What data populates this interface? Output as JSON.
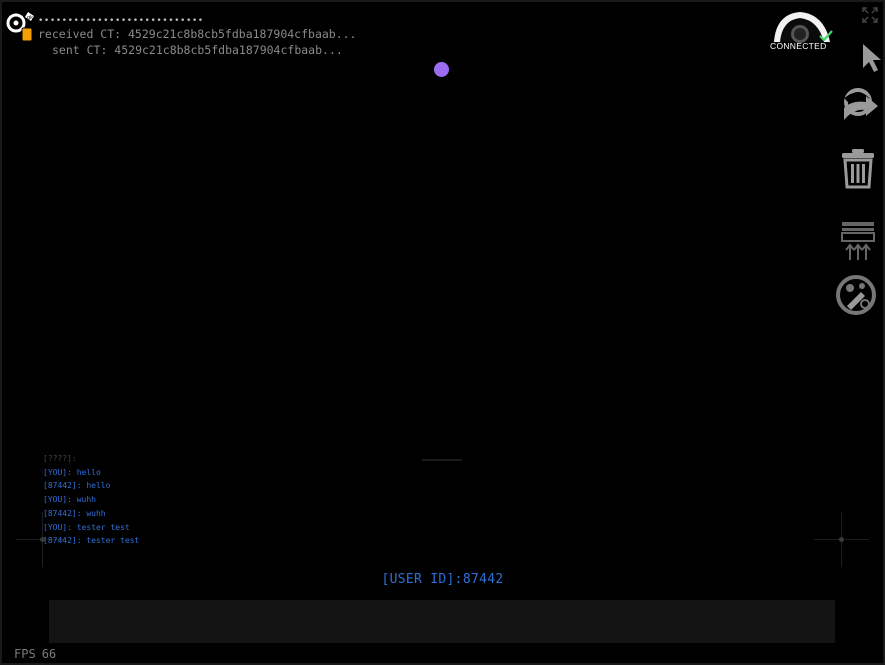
{
  "crypto": {
    "masked_key": "••••••••••••••••••••••••••••",
    "received_ct": "received CT: 4529c21c8b8cb5fdba187904cfbaab...",
    "sent_ct": "sent CT: 4529c21c8b8cb5fdba187904cfbaab..."
  },
  "connection": {
    "status_label": "CONNECTED",
    "status_color": "#43d66b"
  },
  "marker": {
    "color": "#9b6cf2"
  },
  "tools": [
    {
      "icon": "cursor-icon",
      "name": "pointer"
    },
    {
      "icon": "share-icon",
      "name": "share"
    },
    {
      "icon": "trash-icon",
      "name": "delete"
    },
    {
      "icon": "upload-tray-icon",
      "name": "upload"
    },
    {
      "icon": "palette-icon",
      "name": "palette"
    }
  ],
  "chat": {
    "messages": [
      "[????]:",
      "[YOU]: hello",
      "[87442]: hello",
      "[YOU]: wuhh",
      "[87442]: wuhh",
      "[YOU]: tester test",
      "[87442]: tester test"
    ],
    "text_color": "#2f6fd6"
  },
  "user_id_label": "[USER ID]:87442",
  "input": {
    "value": "",
    "placeholder": ""
  },
  "fps": {
    "label": "FPS",
    "value": "66"
  }
}
